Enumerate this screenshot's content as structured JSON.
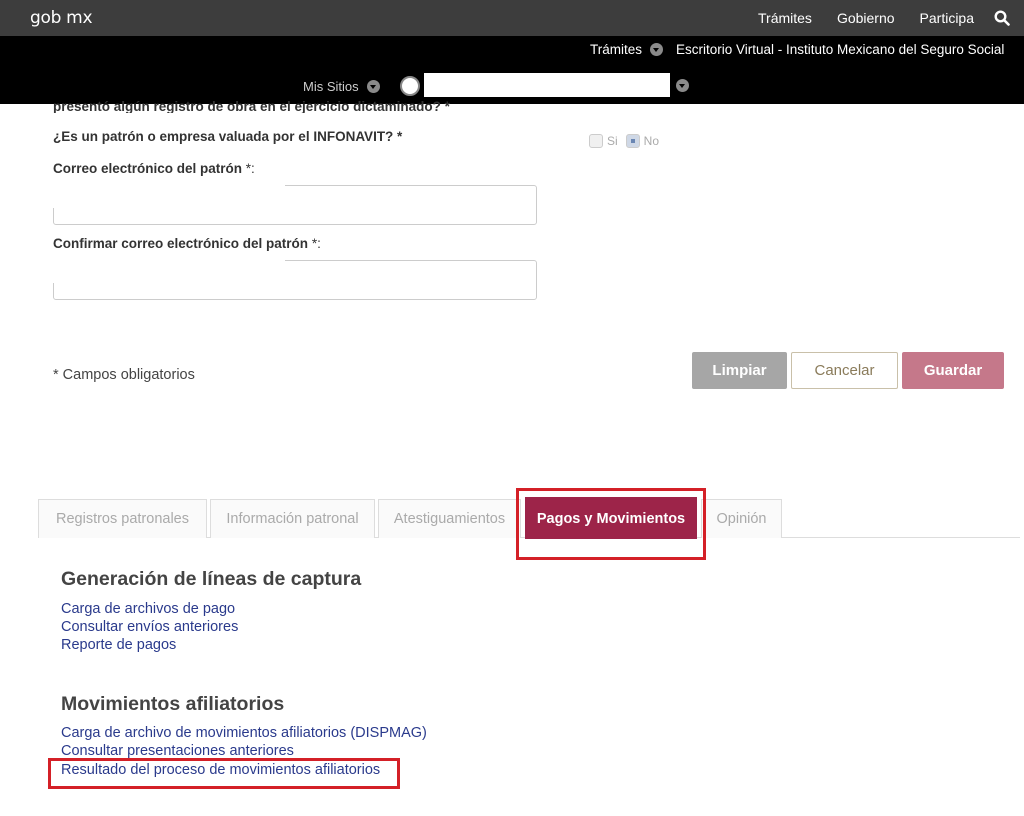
{
  "gob_bar": {
    "logo": "gob mx",
    "nav": [
      "Trámites",
      "Gobierno",
      "Participa"
    ],
    "search_icon": "search-icon"
  },
  "sub_bar": {
    "tramites": "Trámites",
    "title": "Escritorio Virtual - Instituto Mexicano del Seguro Social",
    "mis_sitios": "Mis Sitios"
  },
  "form": {
    "cut_question": "presentó algún registro de obra en el ejercicio dictaminado? *",
    "q_infonavit": "¿Es un patrón o empresa valuada por el INFONAVIT? *",
    "radio_si": "Si",
    "radio_no": "No",
    "selected": "No",
    "email_label": "Correo electrónico del patrón ",
    "email_suffix": "*:",
    "confirm_label": "Confirmar correo electrónico del patrón ",
    "confirm_suffix": "*:",
    "email_value": "",
    "confirm_value": "",
    "required_note": "* Campos obligatorios"
  },
  "buttons": {
    "limpiar": "Limpiar",
    "cancelar": "Cancelar",
    "guardar": "Guardar"
  },
  "tabs": [
    {
      "label": "Registros patronales"
    },
    {
      "label": "Información patronal"
    },
    {
      "label": "Atestiguamientos"
    },
    {
      "label": "Pagos y Movimientos"
    },
    {
      "label": "Opinión"
    }
  ],
  "active_tab": "Pagos y Movimientos",
  "sections": {
    "lineas": {
      "title": "Generación de líneas de captura",
      "links": [
        "Carga de archivos de pago",
        "Consultar envíos anteriores",
        "Reporte de pagos"
      ]
    },
    "movimientos": {
      "title": "Movimientos afiliatorios",
      "links": [
        "Carga de archivo de movimientos afiliatorios (DISPMAG)",
        "Consultar presentaciones anteriores",
        "Resultado del proceso de movimientos afiliatorios"
      ]
    }
  },
  "colors": {
    "accent": "#9d2449",
    "highlight": "#d42027",
    "link": "#2a3a8c"
  }
}
